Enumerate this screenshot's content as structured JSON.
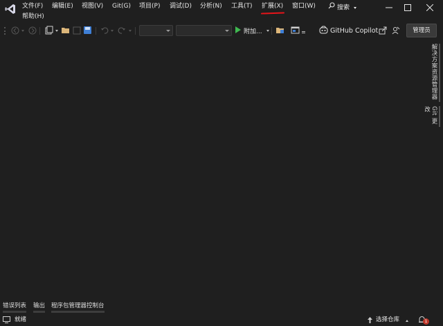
{
  "menu": {
    "items": [
      {
        "label": "文件(F)"
      },
      {
        "label": "编辑(E)"
      },
      {
        "label": "视图(V)"
      },
      {
        "label": "Git(G)"
      },
      {
        "label": "项目(P)"
      },
      {
        "label": "调试(D)"
      },
      {
        "label": "分析(N)"
      },
      {
        "label": "工具(T)"
      },
      {
        "label": "扩展(X)"
      },
      {
        "label": "窗口(W)"
      },
      {
        "label": "帮助(H)"
      }
    ],
    "highlighted": "扩展(X)",
    "highlight_color": "#e8141a"
  },
  "search": {
    "label": "搜索"
  },
  "window_controls": {
    "minimize": "—",
    "maximize": "☐",
    "close": "✕"
  },
  "toolbar": {
    "run_label": "附加...",
    "run_color": "#3fb950",
    "copilot_label": "GitHub Copilot",
    "admin_label": "管理员",
    "icons": [
      "nav-back-icon",
      "nav-forward-icon",
      "new-project-icon",
      "open-folder-icon",
      "save-icon",
      "save-all-icon",
      "undo-icon",
      "redo-icon",
      "run-icon",
      "folder-icon",
      "browser-icon",
      "copilot-icon",
      "share-icon",
      "feedback-icon"
    ]
  },
  "right_rail": {
    "tabs": [
      {
        "label": "解决方案资源管理器"
      },
      {
        "label": "Git 更改"
      }
    ]
  },
  "bottom_tabs": [
    {
      "label": "错误列表"
    },
    {
      "label": "输出"
    },
    {
      "label": "程序包管理器控制台"
    }
  ],
  "statusbar": {
    "ready": "就绪",
    "repo": "选择仓库",
    "notifications": "1"
  },
  "colors": {
    "background": "#1f1f1f",
    "text": "#e6e6e6"
  }
}
